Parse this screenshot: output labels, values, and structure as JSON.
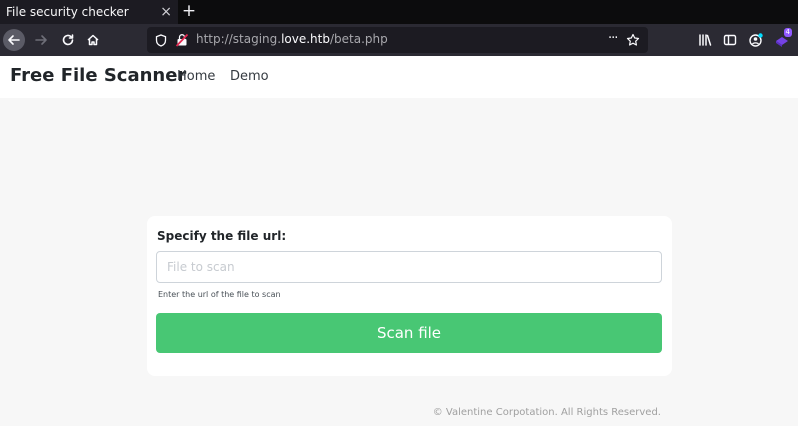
{
  "browser": {
    "tab_title": "File security checker",
    "tab_close": "×",
    "new_tab": "+",
    "url_scheme": "http://staging.",
    "url_host": "love.htb",
    "url_path": "/beta.php",
    "page_actions": "···",
    "notification_badge": "4"
  },
  "site": {
    "brand": "Free File Scanner",
    "nav": [
      {
        "label": "Home"
      },
      {
        "label": "Demo"
      }
    ]
  },
  "form": {
    "label": "Specify the file url:",
    "input_placeholder": "File to scan",
    "input_value": "",
    "help_text": "Enter the url of the file to scan",
    "submit_label": "Scan file"
  },
  "footer": {
    "copyright": "© Valentine Corpotation. All Rights Reserved."
  },
  "colors": {
    "accent_button": "#48c774",
    "browser_dark": "#2b2a33",
    "tab_active": "#1c1b22",
    "page_bg": "#f7f7f7"
  },
  "icons": {
    "back": "arrow-left-icon",
    "forward": "arrow-right-icon",
    "reload": "reload-icon",
    "home": "home-icon",
    "tracking": "shield-icon",
    "insecure": "insecure-lock-icon",
    "bookmark": "star-icon",
    "library": "library-icon",
    "sidebar": "sidebar-icon",
    "account": "account-icon",
    "extension": "extension-icon"
  }
}
